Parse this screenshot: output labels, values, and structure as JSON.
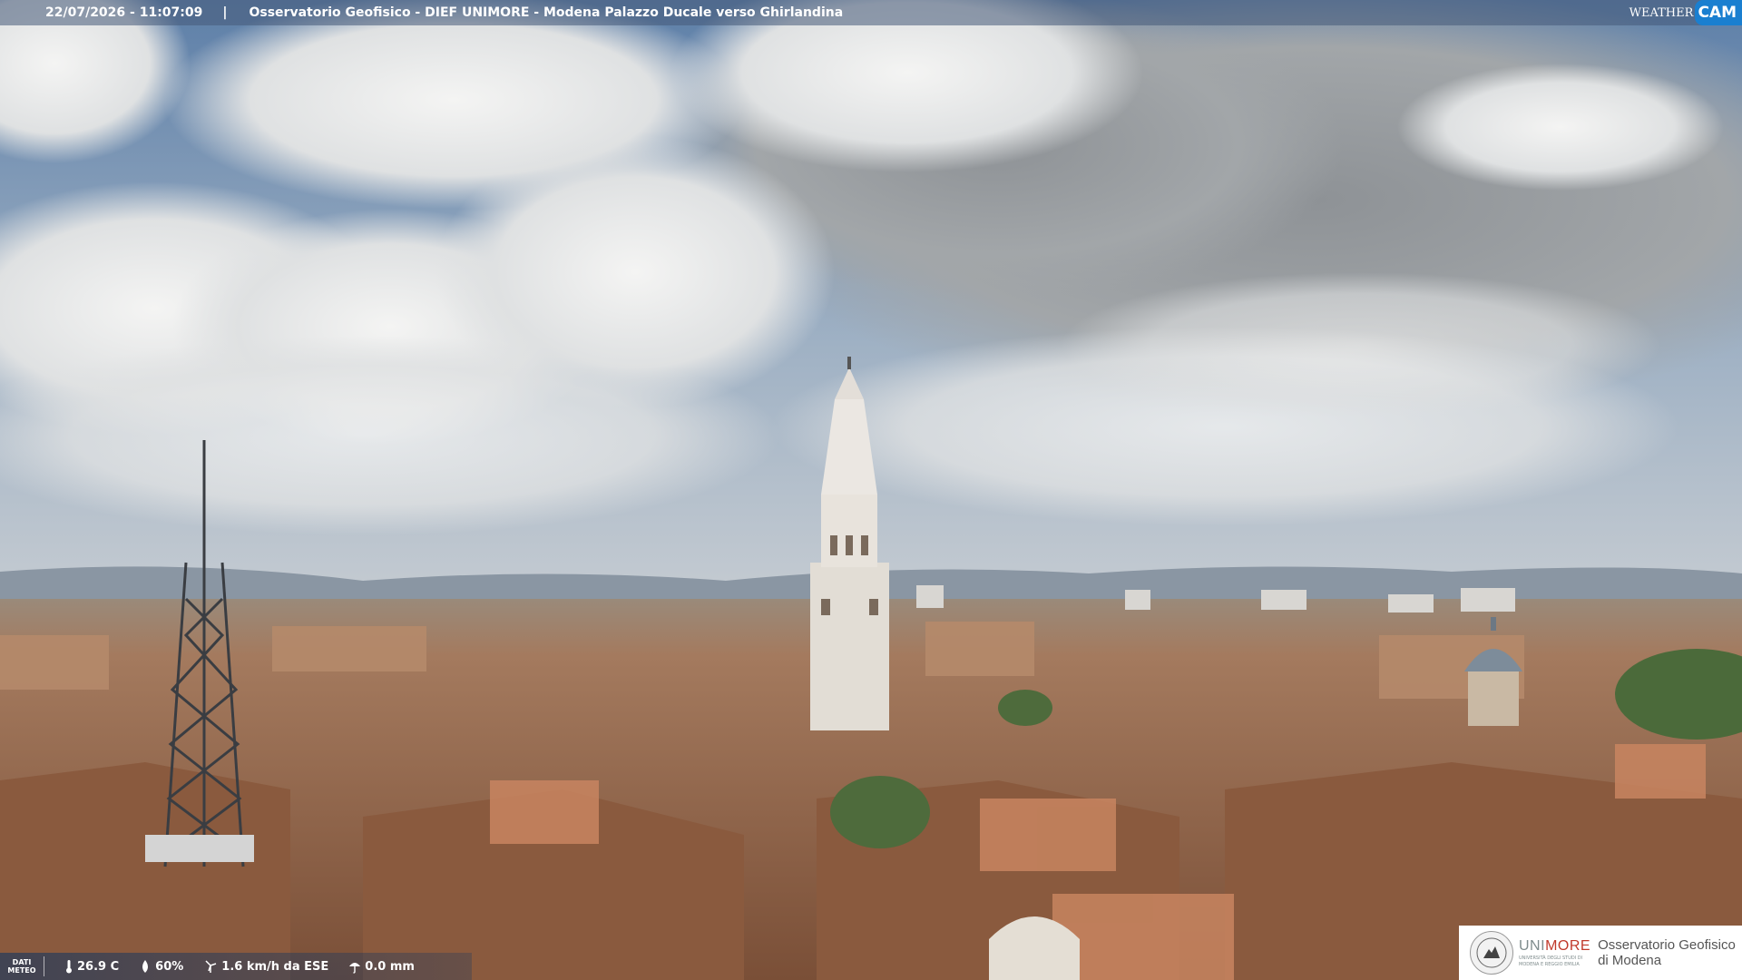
{
  "overlay": {
    "timestamp": "22/07/2026 - 11:07:09",
    "separator": "|",
    "title": "Osservatorio Geofisico - DIEF UNIMORE - Modena Palazzo Ducale verso Ghirlandina",
    "brand_weather": "WEATHER",
    "brand_cam": "CAM"
  },
  "weather": {
    "label_line1": "DATI",
    "label_line2": "METEO",
    "temperature": "26.9 C",
    "humidity": "60%",
    "wind": "1.6 km/h da ESE",
    "rain": "0.0 mm"
  },
  "institution": {
    "name_prefix": "UNI",
    "name_suffix": "MORE",
    "subtitle_1": "UNIVERSITÀ DEGLI STUDI DI",
    "subtitle_2": "MODENA E REGGIO EMILIA",
    "observatory_line1": "Osservatorio Geofisico",
    "observatory_line2": "di Modena"
  },
  "colors": {
    "unimore_red": "#c0392b",
    "weathercam_blue": "#1a7fd0"
  }
}
